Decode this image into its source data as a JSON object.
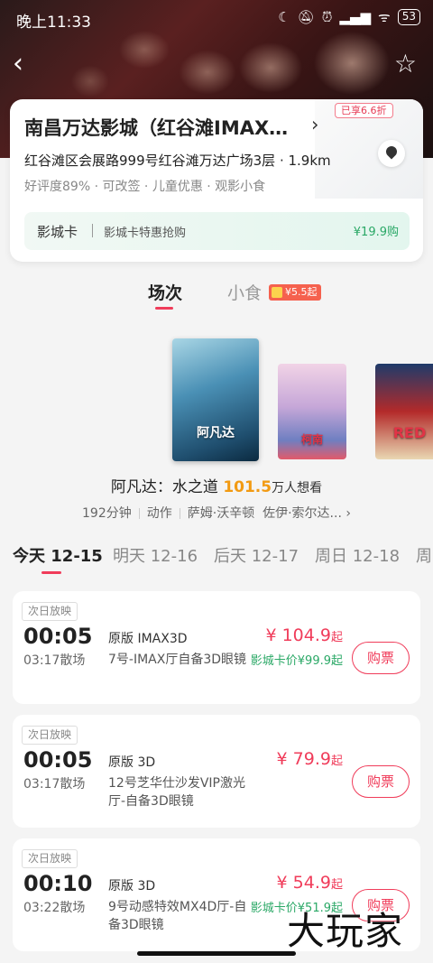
{
  "status_bar": {
    "time": "晚上11:33",
    "icons": [
      "moon-icon",
      "mute-icon",
      "alarm-icon",
      "signal-icon",
      "wifi-icon"
    ],
    "battery": "53"
  },
  "cinema": {
    "name": "南昌万达影城（红谷滩IMAX…",
    "address": "红谷滩区会展路999号红谷滩万达广场3层",
    "distance": "1.9km",
    "address_line": "红谷滩区会展路999号红谷滩万达广场3层 · 1.9km",
    "tags": "好评度89% · 可改签 · 儿童优惠 · 观影小食",
    "card": {
      "title": "影城卡",
      "desc": "影城卡特惠抢购",
      "price": "¥19.9购",
      "discount": "已享6.6折"
    }
  },
  "tabs": {
    "show": "场次",
    "snack": "小食",
    "snack_badge": "¥5.5起"
  },
  "posters": [
    {
      "title": "阿凡达"
    },
    {
      "title": "柯南"
    },
    {
      "title": "RED"
    }
  ],
  "movie": {
    "title": "阿凡达：水之道",
    "want_count": "101.5",
    "want_suffix": "万人想看",
    "duration": "192分钟",
    "genre": "动作",
    "cast": "萨姆·沃辛顿",
    "cast2": "佐伊·索尔达..."
  },
  "dates": [
    {
      "label": "今天 12-15"
    },
    {
      "label": "明天 12-16"
    },
    {
      "label": "后天 12-17"
    },
    {
      "label": "周日 12-18"
    },
    {
      "label": "周"
    }
  ],
  "sessions": [
    {
      "tag": "次日放映",
      "start": "00:05",
      "end": "03:17散场",
      "lang": "原版 IMAX3D",
      "hall": "7号-IMAX厅自备3D眼镜",
      "price": "¥ 104.9",
      "qi": "起",
      "member": "影城卡价¥99.9起",
      "buy": "购票"
    },
    {
      "tag": "次日放映",
      "start": "00:05",
      "end": "03:17散场",
      "lang": "原版 3D",
      "hall": "12号芝华仕沙发VIP激光厅-自备3D眼镜",
      "price": "¥ 79.9",
      "qi": "起",
      "member": "",
      "buy": "购票"
    },
    {
      "tag": "次日放映",
      "start": "00:10",
      "end": "03:22散场",
      "lang": "原版 3D",
      "hall": "9号动感特效MX4D厅-自备3D眼镜",
      "price": "¥ 54.9",
      "qi": "起",
      "member": "影城卡价¥51.9起",
      "buy": "购票"
    }
  ],
  "watermark": "大玩家"
}
